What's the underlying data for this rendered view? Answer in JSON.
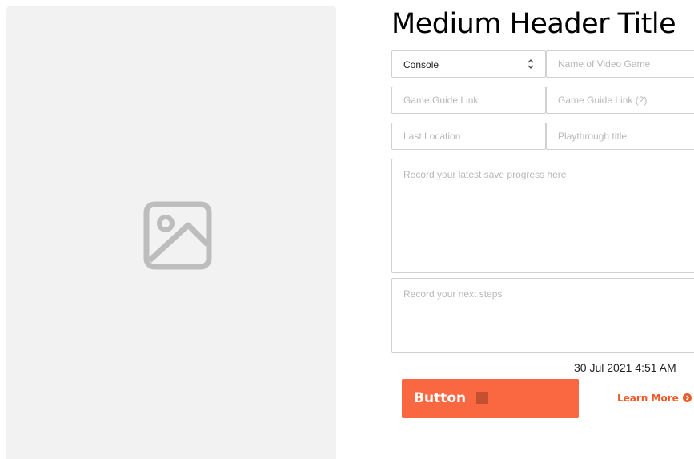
{
  "header": {
    "title": "Medium Header Title"
  },
  "form": {
    "console": {
      "value": "Console"
    },
    "game_name": {
      "placeholder": "Name of Video Game",
      "value": ""
    },
    "guide_link_1": {
      "placeholder": "Game Guide Link",
      "value": ""
    },
    "guide_link_2": {
      "placeholder": "Game Guide Link (2)",
      "value": ""
    },
    "last_location": {
      "placeholder": "Last Location",
      "value": ""
    },
    "playthrough_title": {
      "placeholder": "Playthrough title",
      "value": ""
    },
    "save_progress": {
      "placeholder": "Record your latest save progress here",
      "value": ""
    },
    "next_steps": {
      "placeholder": "Record your next steps",
      "value": ""
    }
  },
  "timestamp": "30 Jul 2021 4:51 AM",
  "actions": {
    "primary_button_label": "Button",
    "learn_more_label": "Learn More"
  },
  "colors": {
    "accent": "#f96841",
    "link": "#f05a28",
    "image_placeholder_bg": "#f2f2f2"
  },
  "icons": {
    "image_placeholder": "image-icon",
    "select_chevron": "chevron-up-down-icon",
    "learn_more_arrow": "arrow-right-circle-icon"
  }
}
